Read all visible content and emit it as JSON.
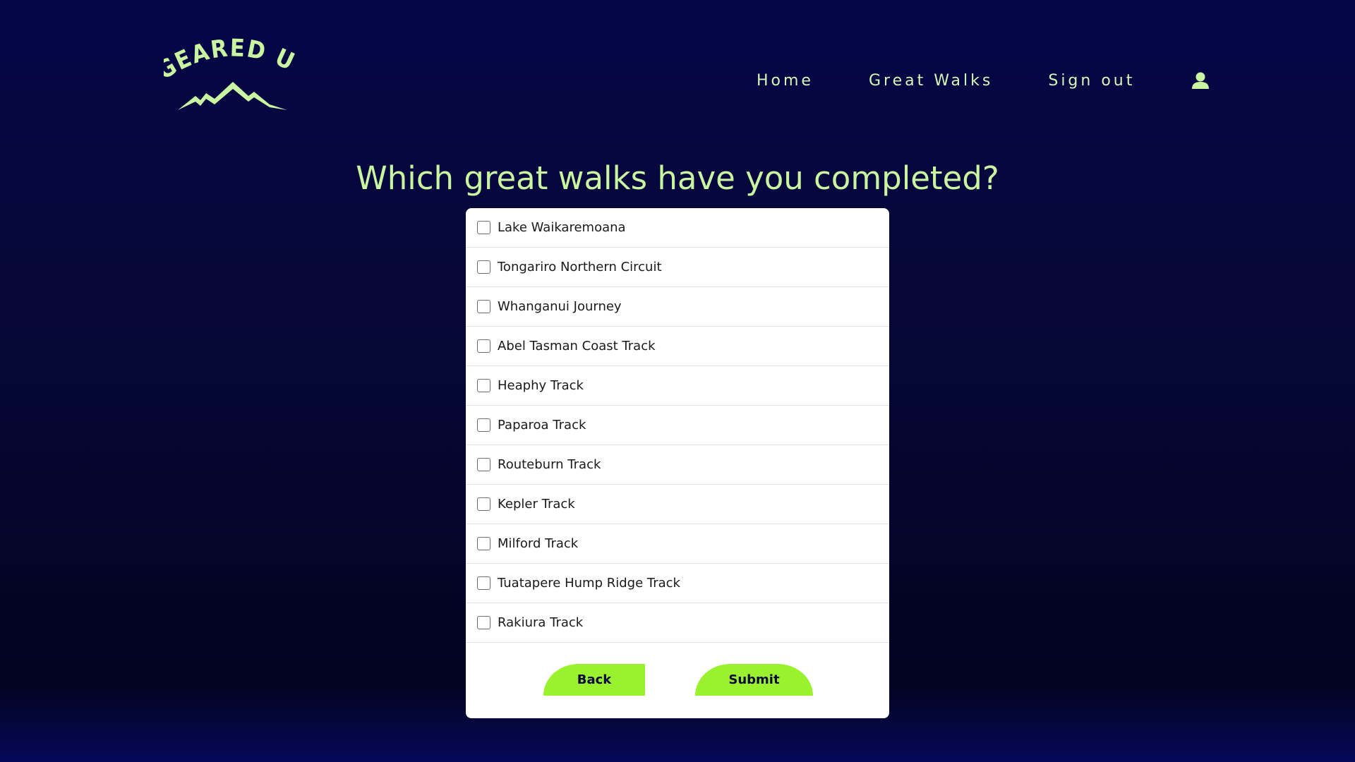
{
  "header": {
    "logo_text": "GEARED UP",
    "nav": [
      {
        "label": "Home"
      },
      {
        "label": "Great Walks"
      },
      {
        "label": "Sign out"
      }
    ],
    "user_icon": "user-icon"
  },
  "main": {
    "heading": "Which great walks have you completed?",
    "walks": [
      {
        "label": "Lake Waikaremoana",
        "checked": false
      },
      {
        "label": "Tongariro Northern Circuit",
        "checked": false
      },
      {
        "label": "Whanganui Journey",
        "checked": false
      },
      {
        "label": "Abel Tasman Coast Track",
        "checked": false
      },
      {
        "label": "Heaphy Track",
        "checked": false
      },
      {
        "label": "Paparoa Track",
        "checked": false
      },
      {
        "label": "Routeburn Track",
        "checked": false
      },
      {
        "label": "Kepler Track",
        "checked": false
      },
      {
        "label": "Milford Track",
        "checked": false
      },
      {
        "label": "Tuatapere Hump Ridge Track",
        "checked": false
      },
      {
        "label": "Rakiura Track",
        "checked": false
      }
    ],
    "back_label": "Back",
    "submit_label": "Submit"
  },
  "colors": {
    "background": "#06073a",
    "accent_text": "#c9f5a0",
    "button": "#9af22e",
    "button_text": "#06083e"
  }
}
